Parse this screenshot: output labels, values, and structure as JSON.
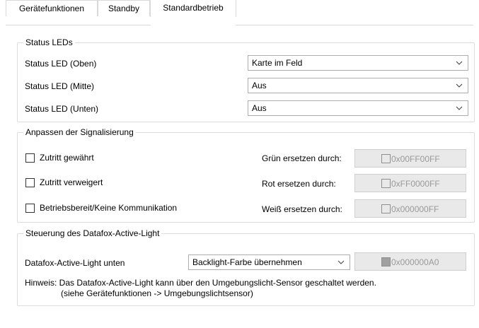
{
  "tabs": [
    {
      "label": "Gerätefunktionen",
      "active": false
    },
    {
      "label": "Standby",
      "active": false
    },
    {
      "label": "Standardbetrieb",
      "active": true
    }
  ],
  "status_leds": {
    "legend": "Status LEDs",
    "rows": [
      {
        "label": "Status LED (Oben)",
        "value": "Karte im Feld"
      },
      {
        "label": "Status LED (Mitte)",
        "value": "Aus"
      },
      {
        "label": "Status LED (Unten)",
        "value": "Aus"
      }
    ]
  },
  "signal": {
    "legend": "Anpassen der Signalisierung",
    "rows": [
      {
        "checkbox_label": "Zutritt gewährt",
        "checked": false,
        "replace_label": "Grün ersetzen durch:",
        "color_value": "0x00FF00FF"
      },
      {
        "checkbox_label": "Zutritt verweigert",
        "checked": false,
        "replace_label": "Rot ersetzen durch:",
        "color_value": "0xFF0000FF"
      },
      {
        "checkbox_label": "Betriebsbereit/Keine Kommunikation",
        "checked": false,
        "replace_label": "Weiß ersetzen durch:",
        "color_value": "0x000000FF"
      }
    ]
  },
  "active_light": {
    "legend": "Steuerung des Datafox-Active-Light",
    "label": "Datafox-Active-Light unten",
    "select_value": "Backlight-Farbe übernehmen",
    "color_value": "0x000000A0",
    "hint_line1": "Hinweis: Das Datafox-Active-Light kann über den Umgebungslicht-Sensor geschaltet werden.",
    "hint_line2": "(siehe Gerätefunktionen -> Umgebungslichtsensor)"
  },
  "colors": {
    "border": "#dcdcdc",
    "disabled_bg": "#e9e9e9",
    "disabled_text": "#9a9a9a"
  }
}
